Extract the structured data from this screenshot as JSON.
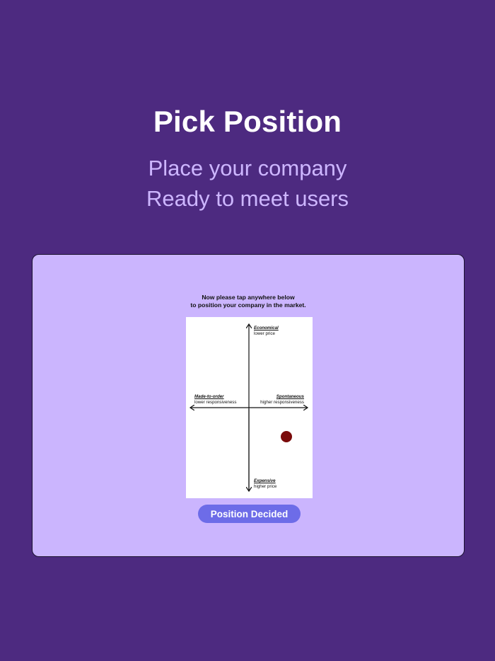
{
  "header": {
    "title": "Pick Position",
    "subtitle_line1": "Place your company",
    "subtitle_line2": "Ready to meet users"
  },
  "card": {
    "instructions_line1": "Now please tap anywhere below",
    "instructions_line2": "to position your company in the market.",
    "map": {
      "top": {
        "title": "Economical",
        "desc": "lower price"
      },
      "bottom": {
        "title": "Expensive",
        "desc": "higher price"
      },
      "left": {
        "title": "Made-to-order",
        "desc": "lower responsiveness"
      },
      "right": {
        "title": "Spontaneous",
        "desc": "higher responsiveness"
      },
      "marker_color": "#7a0a0a"
    },
    "button_label": "Position Decided"
  },
  "colors": {
    "background": "#4d2a80",
    "card": "#cbb5fe",
    "title": "#ffffff",
    "subtitle": "#cdb6ff",
    "button": "#6d6ce8"
  }
}
